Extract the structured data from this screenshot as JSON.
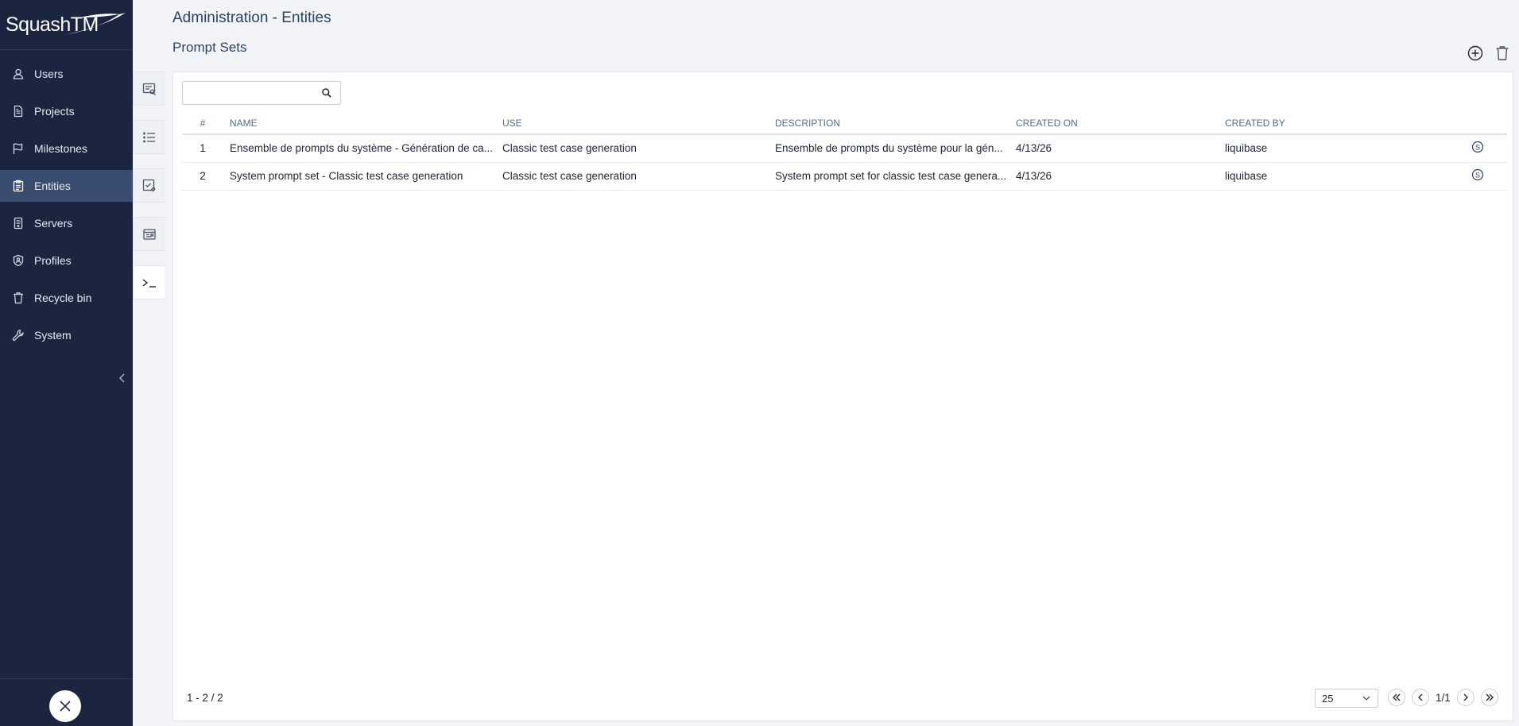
{
  "app": {
    "logo": "SquashTM"
  },
  "sidebar": {
    "items": [
      {
        "label": "Users",
        "icon": "user-icon"
      },
      {
        "label": "Projects",
        "icon": "document-icon"
      },
      {
        "label": "Milestones",
        "icon": "flag-icon"
      },
      {
        "label": "Entities",
        "icon": "clipboard-icon",
        "active": true
      },
      {
        "label": "Servers",
        "icon": "server-icon"
      },
      {
        "label": "Profiles",
        "icon": "shield-user-icon"
      },
      {
        "label": "Recycle bin",
        "icon": "trash-icon"
      },
      {
        "label": "System",
        "icon": "wrench-icon"
      }
    ]
  },
  "header": {
    "title": "Administration - Entities",
    "section": "Prompt Sets"
  },
  "search": {
    "placeholder": "",
    "value": ""
  },
  "table": {
    "headers": {
      "idx": "#",
      "name": "NAME",
      "use": "USE",
      "description": "DESCRIPTION",
      "created_on": "CREATED ON",
      "created_by": "CREATED BY"
    },
    "rows": [
      {
        "idx": "1",
        "name": "Ensemble de prompts du système - Génération de ca...",
        "use": "Classic test case generation",
        "description": "Ensemble de prompts du système pour la gén...",
        "created_on": "4/13/26",
        "created_by": "liquibase"
      },
      {
        "idx": "2",
        "name": "System prompt set - Classic test case generation",
        "use": "Classic test case generation",
        "description": "System prompt set for classic test case genera...",
        "created_on": "4/13/26",
        "created_by": "liquibase"
      }
    ]
  },
  "footer": {
    "count": "1 - 2 / 2",
    "page_size": "25",
    "page": "1/1"
  },
  "colors": {
    "sidebar_bg": "#1b2540",
    "sidebar_active": "#3a4b70",
    "title": "#2d4262"
  }
}
